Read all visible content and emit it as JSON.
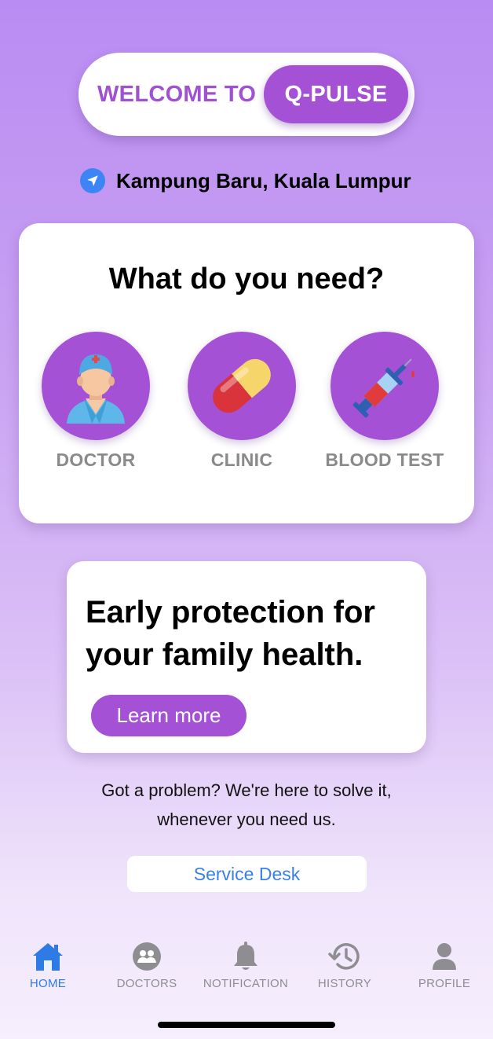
{
  "header": {
    "welcome_label": "WELCOME TO",
    "brand_label": "Q-PULSE"
  },
  "location": {
    "icon": "location-arrow-icon",
    "text": "Kampung Baru, Kuala Lumpur"
  },
  "need_card": {
    "title": "What do you need?",
    "services": [
      {
        "label": "DOCTOR",
        "icon": "doctor-icon"
      },
      {
        "label": "CLINIC",
        "icon": "pill-capsule-icon"
      },
      {
        "label": "BLOOD TEST",
        "icon": "syringe-icon"
      }
    ]
  },
  "promo": {
    "headline": "Early protection for your family health.",
    "button_label": "Learn more"
  },
  "support": {
    "line1": "Got a problem? We're here to solve it,",
    "line2": "whenever you need us.",
    "button_label": "Service Desk"
  },
  "tabbar": {
    "items": [
      {
        "label": "HOME",
        "icon": "home-icon",
        "active": true
      },
      {
        "label": "DOCTORS",
        "icon": "doctors-group-icon",
        "active": false
      },
      {
        "label": "NOTIFICATION",
        "icon": "bell-icon",
        "active": false
      },
      {
        "label": "HISTORY",
        "icon": "history-clock-icon",
        "active": false
      },
      {
        "label": "PROFILE",
        "icon": "profile-person-icon",
        "active": false
      }
    ]
  },
  "colors": {
    "brand_purple": "#a451d6",
    "active_tab_blue": "#2f7be6",
    "link_blue": "#3a7fe8"
  }
}
